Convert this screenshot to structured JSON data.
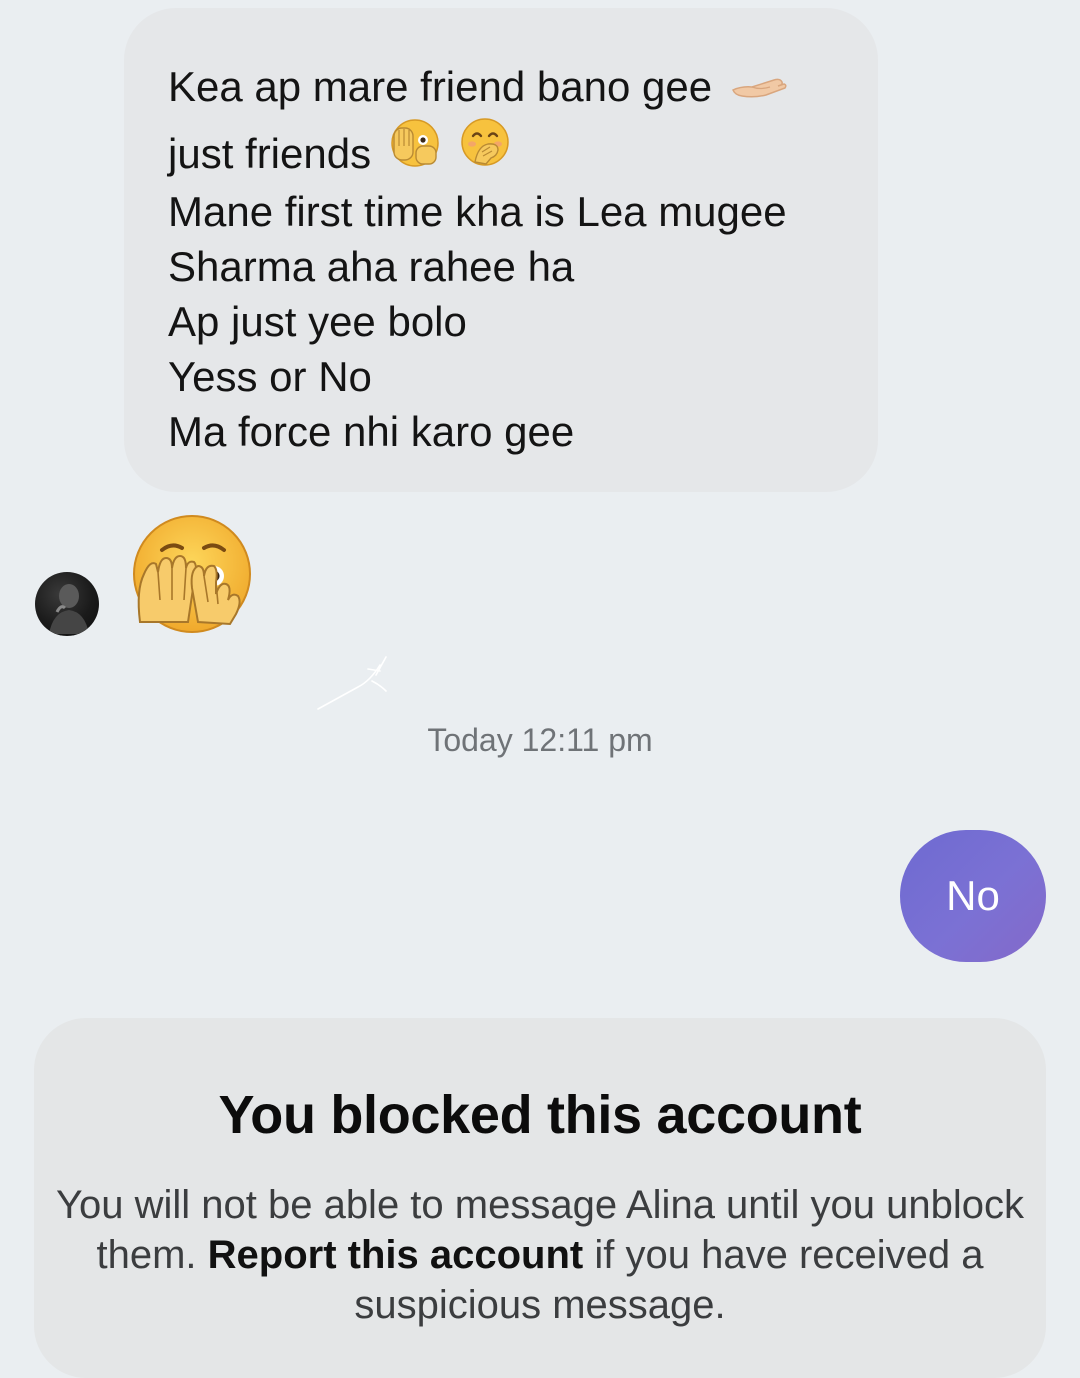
{
  "conversation": {
    "incoming_message": {
      "lines": [
        "Kea ap mare friend bano gee",
        "just friends",
        "Mane first time kha is Lea mugee",
        "Sharma aha rahee ha",
        "Ap just yee bolo",
        "Yess or No",
        "Ma force nhi karo gee"
      ],
      "emojis": {
        "line_1": "palm-up-hand-icon",
        "line_2": [
          "face-with-peeking-eye-icon",
          "face-with-hand-over-mouth-icon"
        ]
      }
    },
    "reaction_emoji": "face-with-peeking-eye-icon",
    "timestamp": "Today 12:11 pm",
    "outgoing_message": "No"
  },
  "blocked_notice": {
    "title": "You blocked this account",
    "body_before": "You will not be able to message Alina until you unblock them.",
    "report_link": "Report this account",
    "body_after": "if you have received a suspicious message."
  },
  "colors": {
    "background": "#eaeef1",
    "incoming_bubble": "#e5e7e9",
    "outgoing_bubble": "#7470d2",
    "notice_card": "#e4e6e7"
  }
}
